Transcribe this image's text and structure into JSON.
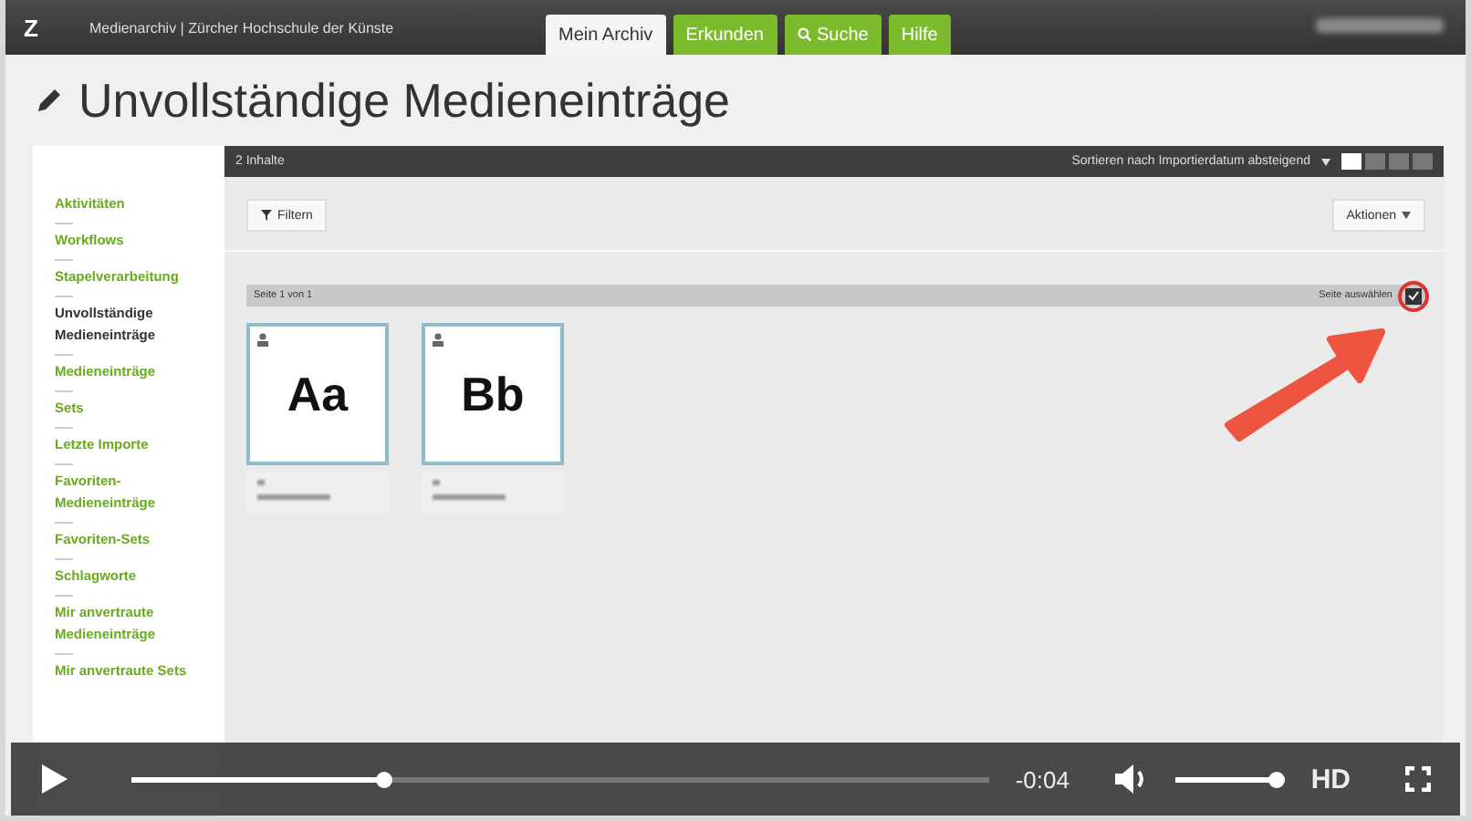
{
  "app_bar": {
    "logo": "Z",
    "site_title": "Medienarchiv | Zürcher Hochschule der Künste",
    "tabs": [
      {
        "label": "Mein Archiv",
        "selected": true,
        "kind": "text"
      },
      {
        "label": "Erkunden",
        "selected": false,
        "kind": "text"
      },
      {
        "label": "Suche",
        "selected": false,
        "kind": "search"
      },
      {
        "label": "Hilfe",
        "selected": false,
        "kind": "text"
      }
    ]
  },
  "page_title": "Unvollständige Medieneinträge",
  "sidebar": {
    "items": [
      {
        "label": "Aktivitäten",
        "selected": false
      },
      {
        "label": "Workflows",
        "selected": false
      },
      {
        "label": "Stapelverarbeitung",
        "selected": false
      },
      {
        "label": "Unvollständige Medieneinträge",
        "selected": true
      },
      {
        "label": "Medieneinträge",
        "selected": false
      },
      {
        "label": "Sets",
        "selected": false
      },
      {
        "label": "Letzte Importe",
        "selected": false
      },
      {
        "label": "Favoriten-Medieneinträge",
        "selected": false
      },
      {
        "label": "Favoriten-Sets",
        "selected": false
      },
      {
        "label": "Schlagworte",
        "selected": false
      },
      {
        "label": "Mir anvertraute Medieneinträge",
        "selected": false
      },
      {
        "label": "Mir anvertraute Sets",
        "selected": false
      }
    ]
  },
  "toolbar": {
    "count": "2 Inhalte",
    "sort": "Sortieren nach Importierdatum absteigend",
    "view_modes": [
      {
        "selected": true
      },
      {
        "selected": false
      },
      {
        "selected": false
      },
      {
        "selected": false
      }
    ],
    "filter_button": "Filtern",
    "actions_button": "Aktionen"
  },
  "pagination": {
    "page_label": "Seite 1 von 1",
    "select_page": "Seite auswählen"
  },
  "cards": [
    {
      "thumbnail": "Aa"
    },
    {
      "thumbnail": "Bb"
    }
  ],
  "video_player": {
    "progress": {
      "level": 0.29
    },
    "time": "-0:04",
    "volume": {
      "level": 1
    },
    "quality": "HD"
  }
}
